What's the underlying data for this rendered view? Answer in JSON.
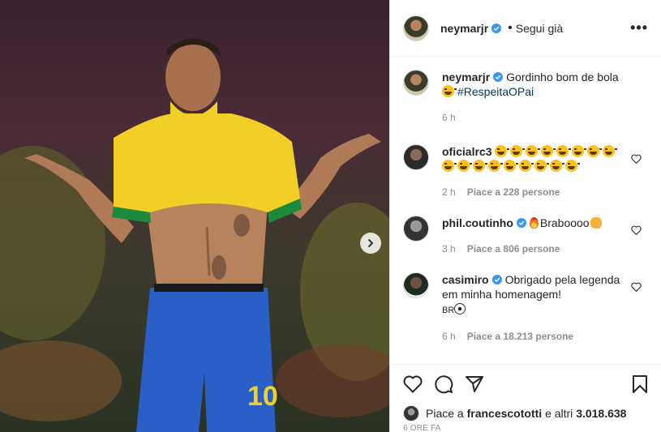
{
  "post": {
    "username": "neymarjr",
    "follow_status": "Segui già",
    "more": "•••"
  },
  "caption": {
    "username": "neymarjr",
    "text": "Gordinho bom de bola",
    "hashtag": "#RespeitaOPai",
    "time": "6 h"
  },
  "comments": [
    {
      "username": "oficialrc3",
      "text": "",
      "time": "2 h",
      "likes": "Piace a 228 persone",
      "laugh_emoji_count": 17
    },
    {
      "username": "phil.coutinho",
      "text": "Braboooo",
      "time": "3 h",
      "likes": "Piace a 806 persone"
    },
    {
      "username": "casimiro",
      "text": "Obrigado pela legenda em minha homenagem!",
      "text2": "BR",
      "time": "6 h",
      "likes": "Piace a 18.213 persone"
    }
  ],
  "likes": {
    "prefix": "Piace a",
    "user": "francescototti",
    "suffix": "e altri",
    "count": "3.018.638"
  },
  "timestamp": "6 ORE FA",
  "icons": [
    "verified-badge",
    "heart-icon",
    "comment-icon",
    "share-icon",
    "bookmark-icon",
    "chevron-right-icon"
  ],
  "colors": {
    "verified": "#3897f0",
    "link": "#00376b",
    "muted": "#8e8e8e"
  }
}
